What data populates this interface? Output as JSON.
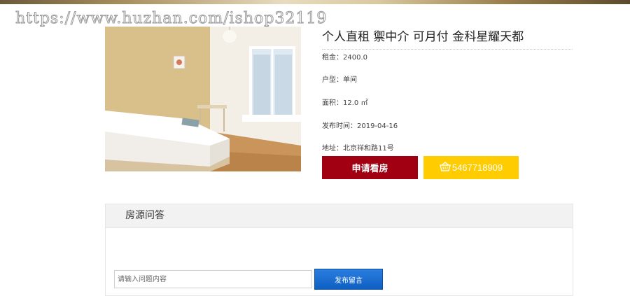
{
  "watermark": "https://www.huzhan.com/ishop32119",
  "listing": {
    "title": "个人直租 禦中介 可月付 金科星耀天都",
    "rent": "租金：2400.0",
    "type": "户型：单间",
    "area": "面积：12.0 ㎡",
    "published": "发布时间：2019-04-16",
    "address": "地址：北京祥和路11号"
  },
  "actions": {
    "apply_label": "申请看房",
    "phone_number": "5467718909"
  },
  "qa": {
    "title": "房源问答",
    "input_placeholder": "请输入问题内容",
    "submit_label": "发布留言"
  },
  "colors": {
    "apply_button": "#a10012",
    "phone_button": "#ffcc00",
    "submit_button": "#1a6fd6"
  },
  "icons": {
    "phone_button_icon": "basket-icon"
  }
}
